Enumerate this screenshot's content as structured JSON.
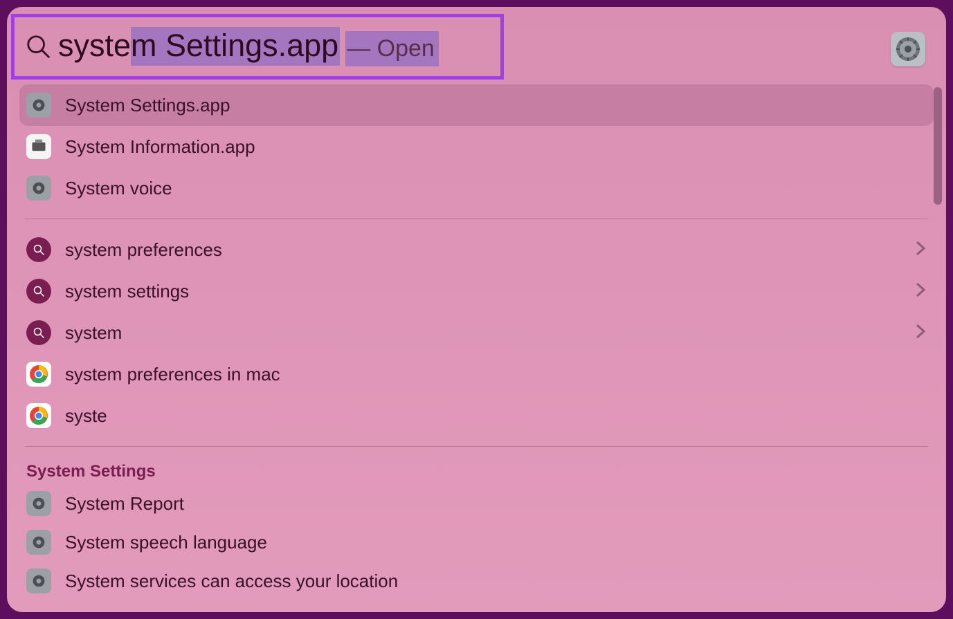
{
  "search": {
    "typed_prefix": "syste",
    "completion_highlight": "m Settings.app",
    "action_suffix": "— Open",
    "full_query": "system Settings.app"
  },
  "top_result_icon": "system-settings-icon",
  "results_apps": [
    {
      "label": "System Settings.app",
      "icon": "gear",
      "selected": true
    },
    {
      "label": "System Information.app",
      "icon": "sysinfo",
      "selected": false
    },
    {
      "label": "System voice",
      "icon": "gear",
      "selected": false
    }
  ],
  "results_suggestions": [
    {
      "label": "system preferences",
      "icon": "searchcircle",
      "chevron": true
    },
    {
      "label": "system settings",
      "icon": "searchcircle",
      "chevron": true
    },
    {
      "label": "system",
      "icon": "searchcircle",
      "chevron": true
    },
    {
      "label": "system preferences in mac",
      "icon": "chrome",
      "chevron": false
    },
    {
      "label": "syste",
      "icon": "chrome",
      "chevron": false
    }
  ],
  "section_title": "System Settings",
  "results_settings": [
    {
      "label": "System Report",
      "icon": "gear"
    },
    {
      "label": "System speech language",
      "icon": "gear"
    },
    {
      "label": "System services can access your location",
      "icon": "gear"
    }
  ]
}
